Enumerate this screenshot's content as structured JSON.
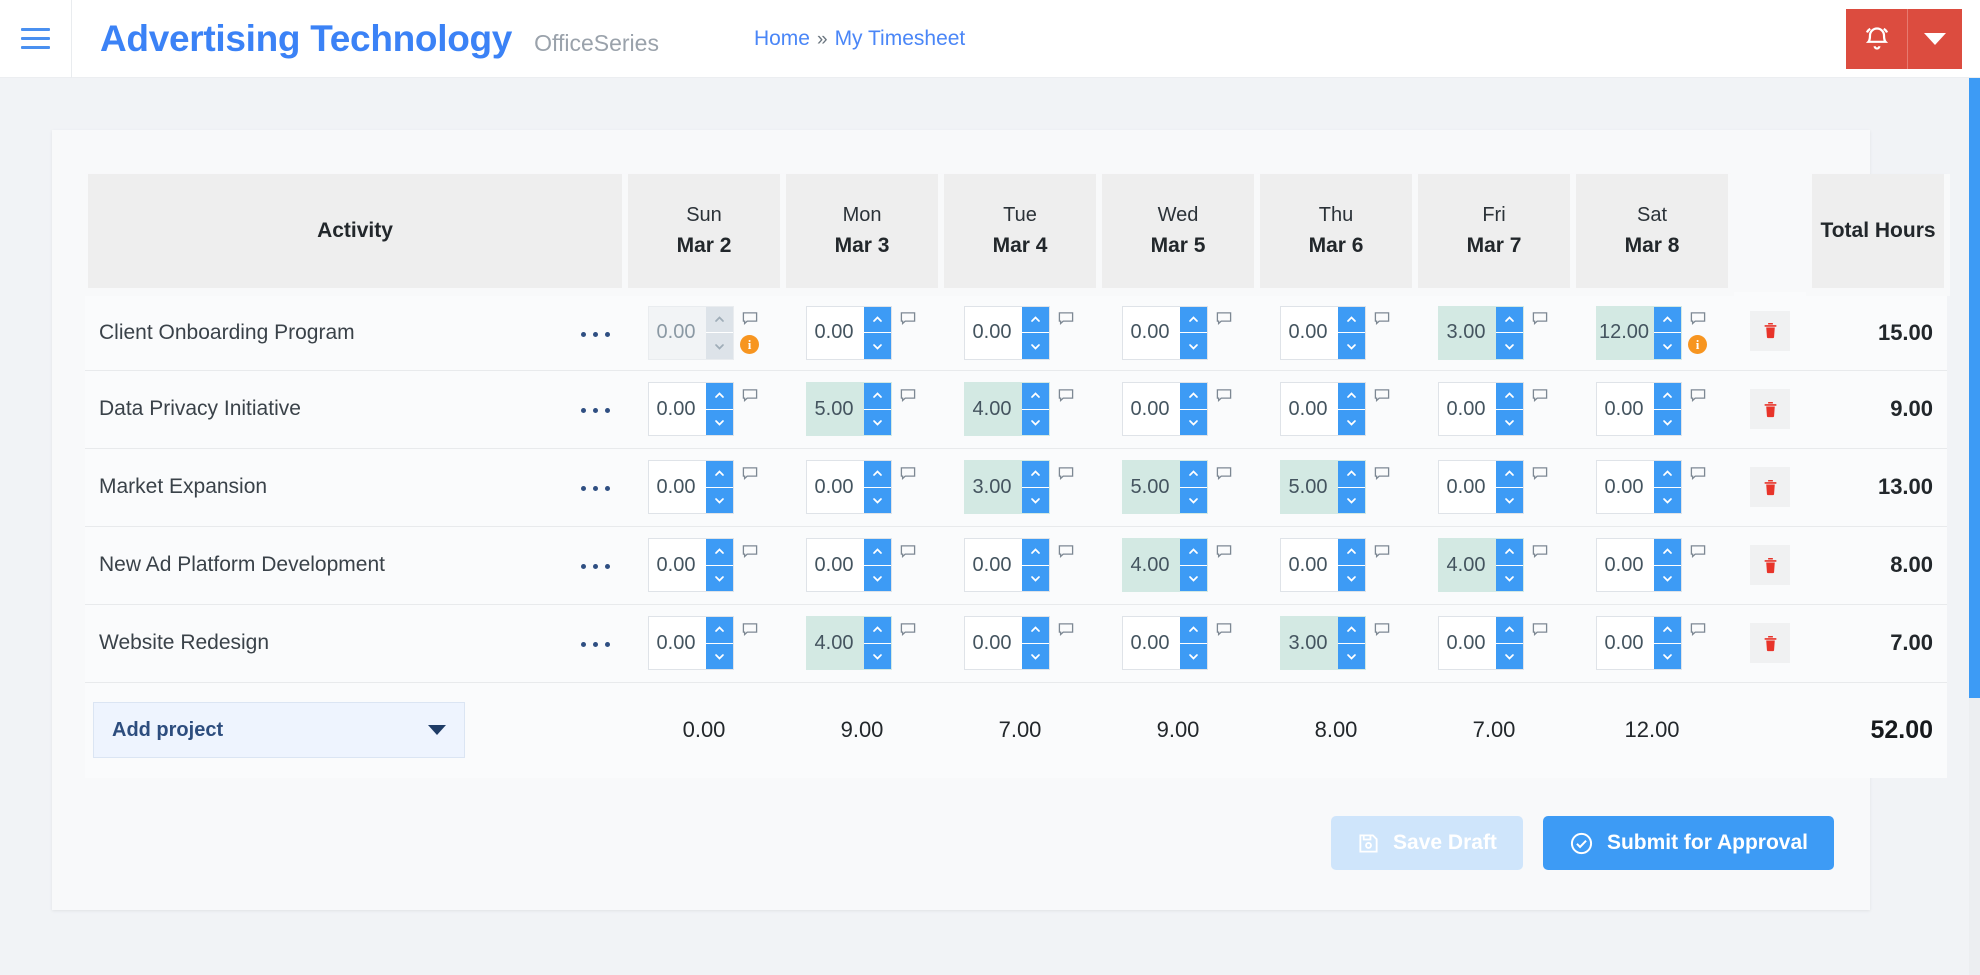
{
  "header": {
    "menu_icon": "hamburger-icon",
    "brand_title": "Advertising Technology",
    "brand_subtitle": "OfficeSeries",
    "breadcrumb": {
      "home": "Home",
      "separator": "»",
      "current": "My Timesheet"
    },
    "notification_icon": "alarm-bell-icon",
    "dropdown_icon": "caret-down-icon",
    "accent_red": "#dc4c3f",
    "accent_blue": "#3b82f6"
  },
  "table": {
    "activity_header": "Activity",
    "total_header": "Total Hours",
    "days": [
      {
        "name": "Sun",
        "date": "Mar 2"
      },
      {
        "name": "Mon",
        "date": "Mar 3"
      },
      {
        "name": "Tue",
        "date": "Mar 4"
      },
      {
        "name": "Wed",
        "date": "Mar 5"
      },
      {
        "name": "Thu",
        "date": "Mar 6"
      },
      {
        "name": "Fri",
        "date": "Mar 7"
      },
      {
        "name": "Sat",
        "date": "Mar 8"
      }
    ],
    "rows": [
      {
        "activity": "Client Onboarding Program",
        "menu_icon": "row-menu-dots-icon",
        "delete_icon": "trash-icon",
        "total": "15.00",
        "cells": [
          {
            "value": "0.00",
            "filled": false,
            "disabled": true,
            "badge": "i"
          },
          {
            "value": "0.00",
            "filled": false,
            "disabled": false,
            "badge": ""
          },
          {
            "value": "0.00",
            "filled": false,
            "disabled": false,
            "badge": ""
          },
          {
            "value": "0.00",
            "filled": false,
            "disabled": false,
            "badge": ""
          },
          {
            "value": "0.00",
            "filled": false,
            "disabled": false,
            "badge": ""
          },
          {
            "value": "3.00",
            "filled": true,
            "disabled": false,
            "badge": ""
          },
          {
            "value": "12.00",
            "filled": true,
            "disabled": false,
            "badge": "i"
          }
        ]
      },
      {
        "activity": "Data Privacy Initiative",
        "menu_icon": "row-menu-dots-icon",
        "delete_icon": "trash-icon",
        "total": "9.00",
        "cells": [
          {
            "value": "0.00",
            "filled": false,
            "disabled": false,
            "badge": ""
          },
          {
            "value": "5.00",
            "filled": true,
            "disabled": false,
            "badge": ""
          },
          {
            "value": "4.00",
            "filled": true,
            "disabled": false,
            "badge": ""
          },
          {
            "value": "0.00",
            "filled": false,
            "disabled": false,
            "badge": ""
          },
          {
            "value": "0.00",
            "filled": false,
            "disabled": false,
            "badge": ""
          },
          {
            "value": "0.00",
            "filled": false,
            "disabled": false,
            "badge": ""
          },
          {
            "value": "0.00",
            "filled": false,
            "disabled": false,
            "badge": ""
          }
        ]
      },
      {
        "activity": "Market Expansion",
        "menu_icon": "row-menu-dots-icon",
        "delete_icon": "trash-icon",
        "total": "13.00",
        "cells": [
          {
            "value": "0.00",
            "filled": false,
            "disabled": false,
            "badge": ""
          },
          {
            "value": "0.00",
            "filled": false,
            "disabled": false,
            "badge": ""
          },
          {
            "value": "3.00",
            "filled": true,
            "disabled": false,
            "badge": ""
          },
          {
            "value": "5.00",
            "filled": true,
            "disabled": false,
            "badge": ""
          },
          {
            "value": "5.00",
            "filled": true,
            "disabled": false,
            "badge": ""
          },
          {
            "value": "0.00",
            "filled": false,
            "disabled": false,
            "badge": ""
          },
          {
            "value": "0.00",
            "filled": false,
            "disabled": false,
            "badge": ""
          }
        ]
      },
      {
        "activity": "New Ad Platform Development",
        "menu_icon": "row-menu-dots-icon",
        "delete_icon": "trash-icon",
        "total": "8.00",
        "cells": [
          {
            "value": "0.00",
            "filled": false,
            "disabled": false,
            "badge": ""
          },
          {
            "value": "0.00",
            "filled": false,
            "disabled": false,
            "badge": ""
          },
          {
            "value": "0.00",
            "filled": false,
            "disabled": false,
            "badge": ""
          },
          {
            "value": "4.00",
            "filled": true,
            "disabled": false,
            "badge": ""
          },
          {
            "value": "0.00",
            "filled": false,
            "disabled": false,
            "badge": ""
          },
          {
            "value": "4.00",
            "filled": true,
            "disabled": false,
            "badge": ""
          },
          {
            "value": "0.00",
            "filled": false,
            "disabled": false,
            "badge": ""
          }
        ]
      },
      {
        "activity": "Website Redesign",
        "menu_icon": "row-menu-dots-icon",
        "delete_icon": "trash-icon",
        "total": "7.00",
        "cells": [
          {
            "value": "0.00",
            "filled": false,
            "disabled": false,
            "badge": ""
          },
          {
            "value": "4.00",
            "filled": true,
            "disabled": false,
            "badge": ""
          },
          {
            "value": "0.00",
            "filled": false,
            "disabled": false,
            "badge": ""
          },
          {
            "value": "0.00",
            "filled": false,
            "disabled": false,
            "badge": ""
          },
          {
            "value": "3.00",
            "filled": true,
            "disabled": false,
            "badge": ""
          },
          {
            "value": "0.00",
            "filled": false,
            "disabled": false,
            "badge": ""
          },
          {
            "value": "0.00",
            "filled": false,
            "disabled": false,
            "badge": ""
          }
        ]
      }
    ],
    "footer": {
      "add_project_label": "Add project",
      "add_project_icon": "caret-down-icon",
      "day_totals": [
        "0.00",
        "9.00",
        "7.00",
        "9.00",
        "8.00",
        "7.00",
        "12.00"
      ],
      "grand_total": "52.00"
    }
  },
  "actions": {
    "save_draft_label": "Save Draft",
    "save_draft_icon": "floppy-disk-icon",
    "save_draft_disabled": true,
    "submit_label": "Submit for Approval",
    "submit_icon": "check-circle-icon"
  },
  "colors": {
    "filled_cell": "#d3e9e3",
    "spinner_blue": "#3d9bf5",
    "badge_orange": "#f79520",
    "delete_red": "#e8342a"
  }
}
